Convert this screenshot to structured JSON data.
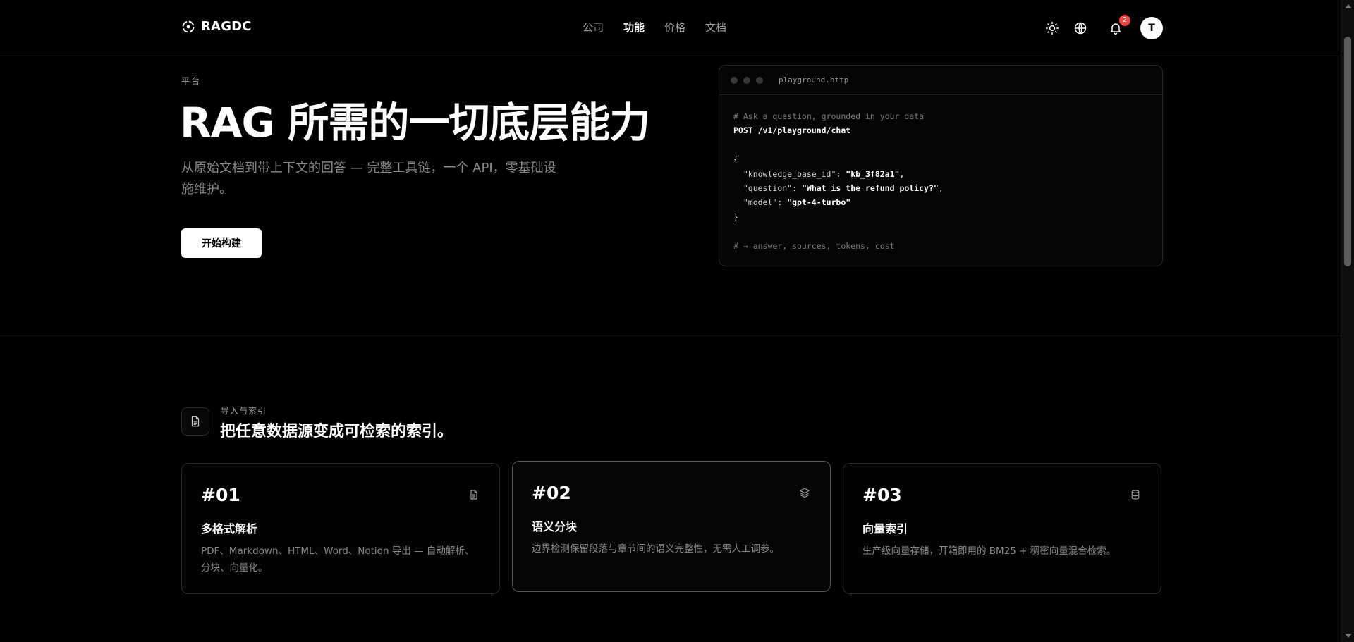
{
  "header": {
    "brand": "RAGDC",
    "nav": [
      {
        "label": "公司",
        "active": false
      },
      {
        "label": "功能",
        "active": true
      },
      {
        "label": "价格",
        "active": false
      },
      {
        "label": "文档",
        "active": false
      }
    ],
    "notification_count": "2",
    "avatar_initial": "T",
    "icons": [
      "sun-icon",
      "globe-icon",
      "bell-icon"
    ]
  },
  "hero": {
    "eyebrow": "平台",
    "title": "RAG 所需的一切底层能力",
    "subtitle": "从原始文档到带上下文的回答 — 完整工具链，一个 API，零基础设施维护。",
    "cta": "开始构建"
  },
  "code_panel": {
    "filename": "playground.http",
    "comment1": "# Ask a question, grounded in your data",
    "request": "POST /v1/playground/chat",
    "open_brace": "{",
    "lines": [
      {
        "key": "\"knowledge_base_id\"",
        "value": "\"kb_3f82a1\"",
        "trail": ","
      },
      {
        "key": "\"question\"",
        "value": "\"What is the refund policy?\"",
        "trail": ","
      },
      {
        "key": "\"model\"",
        "value": "\"gpt-4-turbo\"",
        "trail": ""
      }
    ],
    "close_brace": "}",
    "comment2": "# → answer, sources, tokens, cost"
  },
  "features": {
    "eyebrow": "导入与索引",
    "title": "把任意数据源变成可检索的索引。",
    "cards": [
      {
        "num": "#01",
        "title": "多格式解析",
        "desc": "PDF、Markdown、HTML、Word、Notion 导出 — 自动解析、分块、向量化。",
        "icon": "document-icon"
      },
      {
        "num": "#02",
        "title": "语义分块",
        "desc": "边界检测保留段落与章节间的语义完整性，无需人工调参。",
        "icon": "layers-icon"
      },
      {
        "num": "#03",
        "title": "向量索引",
        "desc": "生产级向量存储，开箱即用的 BM25 + 稠密向量混合检索。",
        "icon": "database-icon"
      }
    ]
  }
}
